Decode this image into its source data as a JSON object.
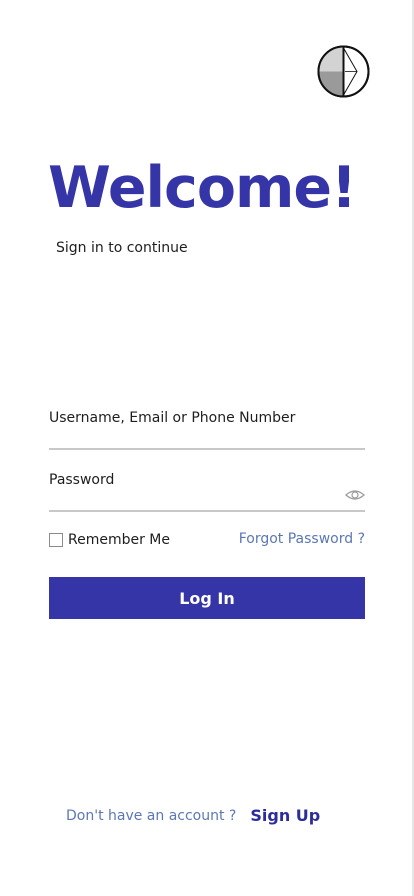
{
  "header": {
    "title": "Welcome!",
    "subtitle": "Sign in to continue"
  },
  "form": {
    "username_label": "Username, Email or Phone Number",
    "username_value": "",
    "password_label": "Password",
    "password_value": "",
    "remember_label": "Remember Me",
    "remember_checked": false,
    "forgot_label": "Forgot Password ?",
    "login_label": "Log In"
  },
  "footer": {
    "prompt": "Don't have an account ?",
    "signup_label": "Sign Up"
  },
  "icons": {
    "logo": "compass-logo-icon",
    "password_toggle": "eye-icon"
  },
  "colors": {
    "primary": "#3535a8",
    "link": "#5b78b4",
    "divider": "#c8c8c8"
  }
}
